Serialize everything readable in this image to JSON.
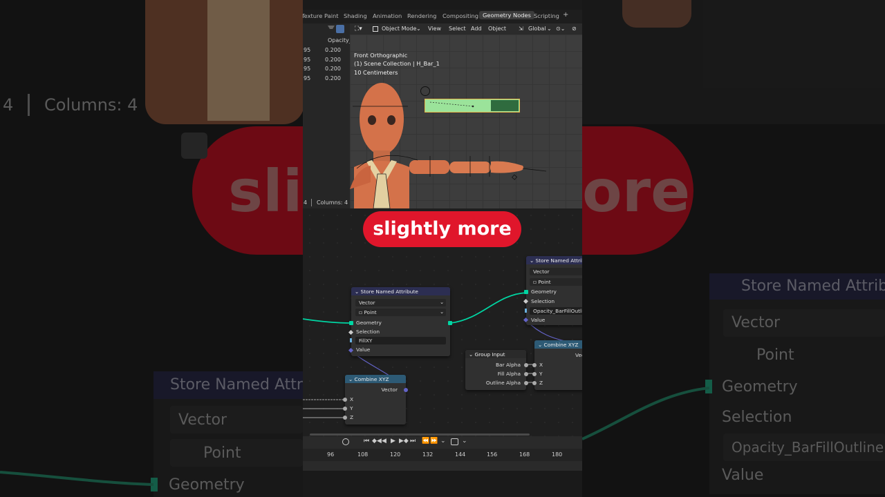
{
  "caption": "slightly more",
  "background": {
    "columns_label": "Columns: 4",
    "columns_prefix": "4",
    "caption_fragment_left": "sli",
    "caption_fragment_right": "ore",
    "node_right": {
      "title": "Store Named Attribu",
      "type": "Vector",
      "domain": "Point",
      "geometry": "Geometry",
      "selection": "Selection",
      "name": "Opacity_BarFillOutline",
      "value": "Value"
    },
    "node_left": {
      "title": "Store Named Attri",
      "type": "Vector",
      "domain": "Point",
      "geometry": "Geometry"
    }
  },
  "workspace_tabs": [
    "Texture Paint",
    "Shading",
    "Animation",
    "Rendering",
    "Compositing",
    "Geometry Nodes",
    "Scripting",
    "+"
  ],
  "active_tab": "Geometry Nodes",
  "spreadsheet": {
    "header": "Opacity_",
    "rows": [
      {
        "index": "95",
        "value": "0.200"
      },
      {
        "index": "95",
        "value": "0.200"
      },
      {
        "index": "95",
        "value": "0.200"
      },
      {
        "index": "95",
        "value": "0.200"
      }
    ],
    "footer_count": "4",
    "footer_columns": "Columns: 4"
  },
  "viewport": {
    "mode": "Object Mode",
    "menus": [
      "View",
      "Select",
      "Add",
      "Object"
    ],
    "orientation": "Global",
    "view_name": "Front Orthographic",
    "collection": "(1) Scene Collection | H_Bar_1",
    "scale": "10 Centimeters"
  },
  "nodes": {
    "store_main": {
      "title": "Store Named Attribute",
      "type": "Vector",
      "domain": "Point",
      "geometry": "Geometry",
      "selection": "Selection",
      "name": "FillXY",
      "value": "Value"
    },
    "store_right": {
      "title": "Store Named Attrib",
      "type": "Vector",
      "domain": "Point",
      "geometry": "Geometry",
      "selection": "Selection",
      "name": "Opacity_BarFillOutlin",
      "value": "Value"
    },
    "combine_left": {
      "title": "Combine XYZ",
      "output": "Vector",
      "x": "X",
      "y": "Y",
      "z": "Z"
    },
    "combine_right": {
      "title": "Combine XYZ",
      "output": "Vec",
      "x": "X",
      "y": "Y",
      "z": "Z"
    },
    "group_input": {
      "title": "Group Input",
      "bar_alpha": "Bar Alpha",
      "fill_alpha": "Fill Alpha",
      "outline_alpha": "Outline Alpha"
    }
  },
  "timeline": {
    "frames": [
      "96",
      "108",
      "120",
      "132",
      "144",
      "156",
      "168",
      "180"
    ]
  },
  "colors": {
    "accent": "#e0162b",
    "geometry_socket": "#00d6a3",
    "vector_socket": "#6363c7",
    "bar_fill": "#9be39a",
    "bar_dark": "#2f6b3e"
  }
}
